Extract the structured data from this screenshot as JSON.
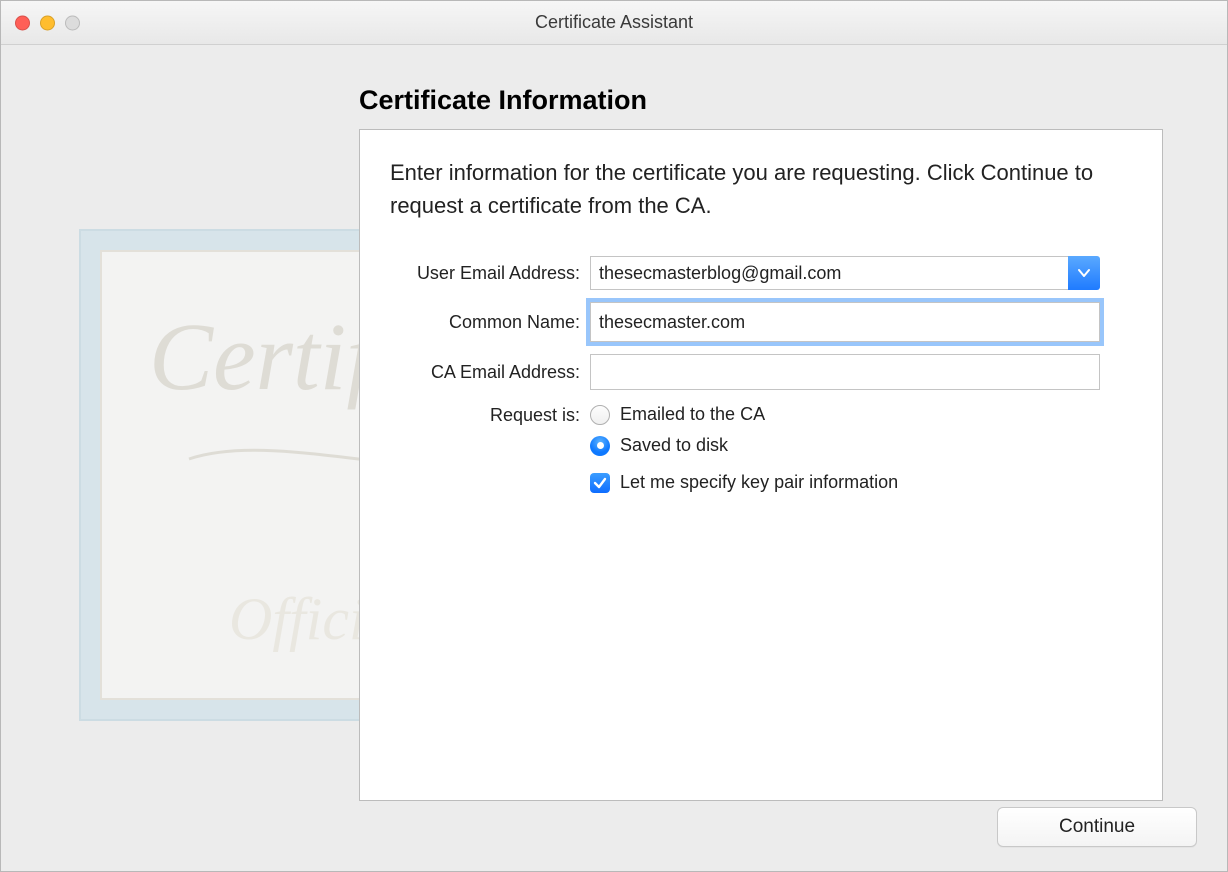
{
  "window": {
    "title": "Certificate Assistant"
  },
  "heading": "Certificate Information",
  "instructions": "Enter information for the certificate you are requesting. Click Continue to request a certificate from the CA.",
  "form": {
    "user_email": {
      "label": "User Email Address:",
      "value": "thesecmasterblog@gmail.com"
    },
    "common_name": {
      "label": "Common Name:",
      "value": "thesecmaster.com"
    },
    "ca_email": {
      "label": "CA Email Address:",
      "value": ""
    },
    "request_is": {
      "label": "Request is:",
      "opt_emailed": "Emailed to the CA",
      "opt_saved": "Saved to disk",
      "selected": "saved"
    },
    "specify_keypair": {
      "label": "Let me specify key pair information",
      "checked": true
    }
  },
  "buttons": {
    "continue": "Continue"
  }
}
